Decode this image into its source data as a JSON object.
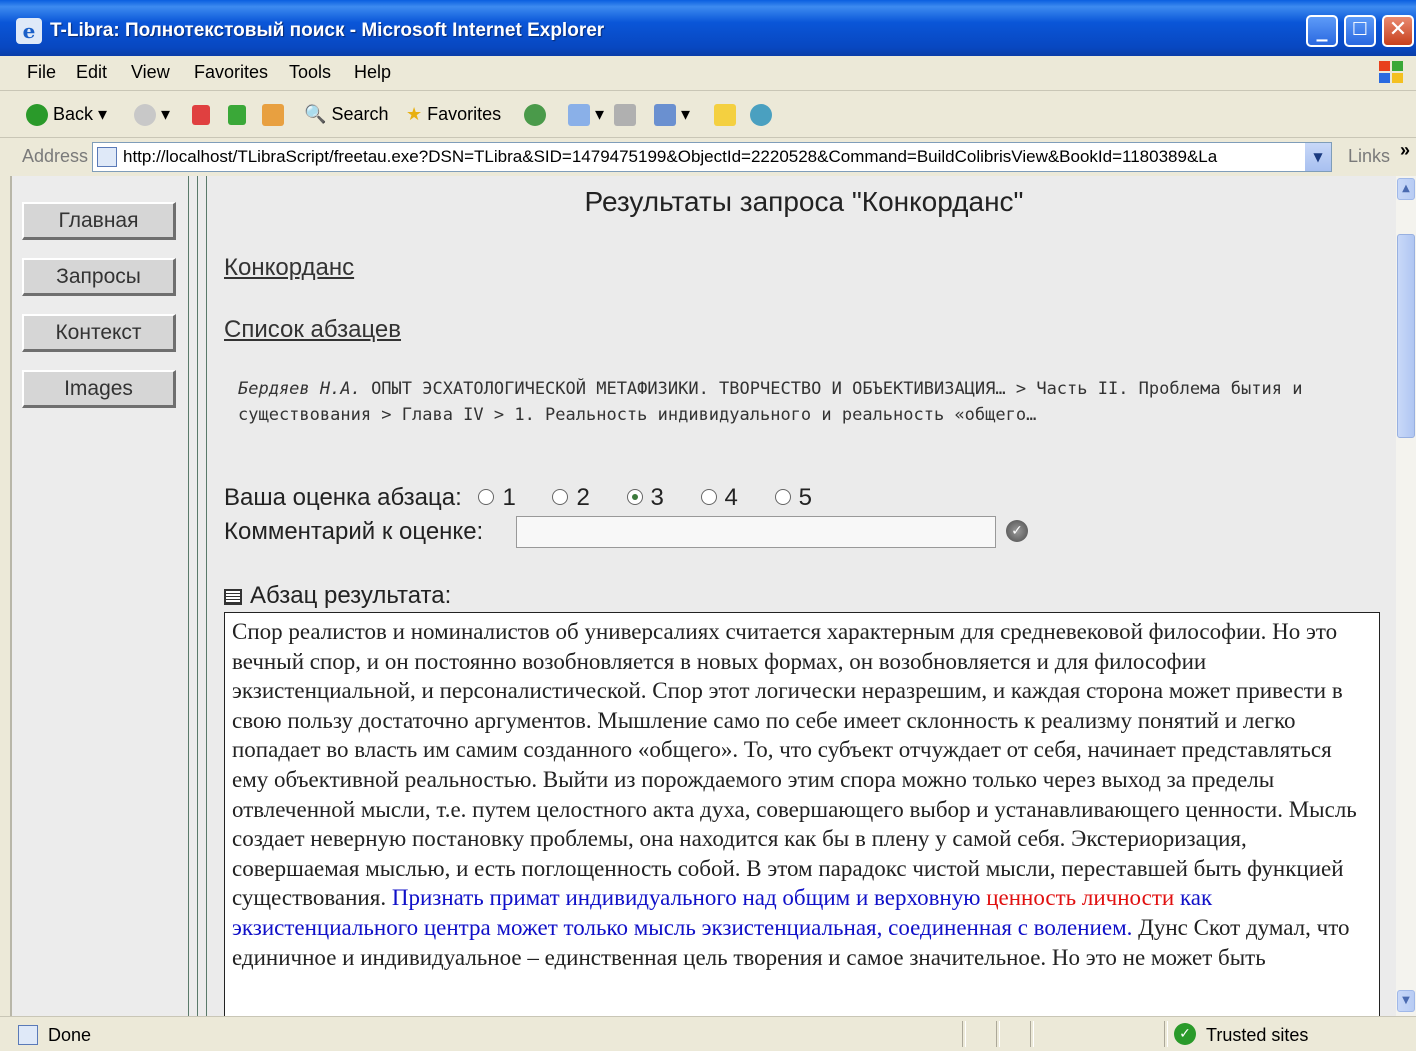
{
  "window": {
    "title": "T-Libra: Полнотекстовый поиск - Microsoft Internet Explorer"
  },
  "menu": [
    "File",
    "Edit",
    "View",
    "Favorites",
    "Tools",
    "Help"
  ],
  "toolbar": {
    "back": "Back",
    "search": "Search",
    "favorites": "Favorites"
  },
  "address": {
    "label": "Address",
    "url": "http://localhost/TLibraScript/freetau.exe?DSN=TLibra&SID=1479475199&ObjectId=2220528&Command=BuildColibrisView&BookId=1180389&La",
    "links": "Links"
  },
  "nav": [
    "Главная",
    "Запросы",
    "Контекст",
    "Images"
  ],
  "page": {
    "title": "Результаты запроса \"Конкорданс\"",
    "link_concordance": "Конкорданс",
    "link_paragraphs": "Список абзацев",
    "breadcrumb_author": "Бердяев Н.А.",
    "breadcrumb_rest": " ОПЫТ ЭСХАТОЛОГИЧЕСКОЙ МЕТАФИЗИКИ. ТВОРЧЕСТВО И ОБЪЕКТИВИЗАЦИЯ… > Часть II. Проблема бытия и существования > Глава IV > 1. Реальность индивидуального и реальность «общего…",
    "rating_label": "Ваша оценка абзаца:",
    "rating_options": [
      "1",
      "2",
      "3",
      "4",
      "5"
    ],
    "rating_selected": "3",
    "comment_label": "Комментарий к оценке:",
    "comment_value": "",
    "result_label": "Абзац результата:",
    "paragraph_plain": "Спор реалистов и номиналистов об универсалиях считается характерным для средневековой философии. Но это вечный спор, и он постоянно возобновляется в новых формах, он возобновляется и для философии экзистенциальной, и персоналистической. Спор этот логически неразрешим, и каждая сторона может привести в свою пользу достаточно аргументов. Мышление само по себе имеет склонность к реализму понятий и легко попадает во власть им самим созданного «общего». То, что субъект отчуждает от себя, начинает представляться ему объективной реальностью. Выйти из порождаемого этим спора можно только через выход за пределы отвлеченной мысли, т.е. путем целостного акта духа, совершающего выбор и устанавливающего ценности. Мысль создает неверную постановку проблемы, она находится как бы в плену у самой себя. Экстериоризация, совершаемая мыслью, и есть поглощенность собой. В этом парадокс чистой мысли, переставшей быть функцией существования. ",
    "paragraph_blue1": "Признать примат индивидуального над общим и верховную ",
    "paragraph_red": "ценность личности",
    "paragraph_blue2": " как экзистенциального центра может только мысль экзистенциальная, соединенная с волением.",
    "paragraph_tail": " Дунс Скот думал, что единичное и индивидуальное – единственная цель творения и самое значительное. Но это не может быть",
    "highlight_blue": "#1010c8",
    "highlight_red": "#e01010"
  },
  "status": {
    "left": "Done",
    "zone": "Trusted sites"
  }
}
